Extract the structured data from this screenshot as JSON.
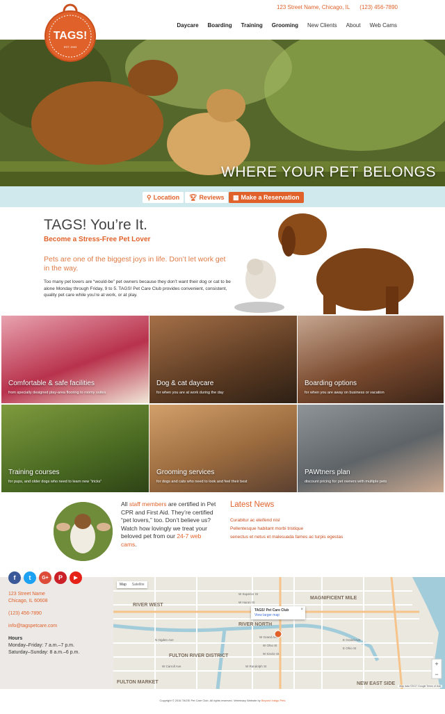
{
  "header": {
    "logo_text": "TAGS!",
    "logo_sub": "EST. 2003",
    "address": "123 Street Name, Chicago, IL",
    "phone": "(123) 456-7890",
    "nav": [
      {
        "label": "Daycare"
      },
      {
        "label": "Boarding"
      },
      {
        "label": "Training"
      },
      {
        "label": "Grooming"
      },
      {
        "label": "New Clients"
      },
      {
        "label": "About"
      },
      {
        "label": "Web Cams"
      }
    ]
  },
  "hero": {
    "tagline": "WHERE YOUR PET BELONGS"
  },
  "actions": {
    "location": "Location",
    "reviews": "Reviews",
    "reservation": "Make a Reservation"
  },
  "intro": {
    "title": "TAGS! You’re It.",
    "subtitle": "Become a Stress-Free Pet Lover",
    "lead": "Pets are one of the biggest joys in life. Don’t let work get in the way.",
    "body": "Too many pet lovers are “would-be” pet owners because they don’t want their dog or cat to be alone Monday through Friday, 9 to 5. TAGS! Pet Care Club provides convenient, consistent, quality pet care while you’re at work, or at play."
  },
  "tiles": [
    {
      "title": "Comfortable & safe facilities",
      "sub": "from specially designed play-area flooring to roomy suites"
    },
    {
      "title": "Dog & cat daycare",
      "sub": "for when you are at work during the day"
    },
    {
      "title": "Boarding options",
      "sub": "for when you are away on business or vacation"
    },
    {
      "title": "Training courses",
      "sub": "for pups, and older dogs who need to learn new “tricks”"
    },
    {
      "title": "Grooming services",
      "sub": "for dogs and cats who need to look and feel their best"
    },
    {
      "title": "PAWtners plan",
      "sub": "discount pricing for pet owners with multiple pets"
    }
  ],
  "staff": {
    "t1": "All ",
    "link1": "staff members",
    "t2": " are certified in Pet CPR and First Aid. They’re certified “pet lovers,” too. Don’t believe us? Watch how lovingly we treat your beloved pet from our ",
    "link2": "24-7 web cams",
    "t3": "."
  },
  "news": {
    "title": "Latest News",
    "items": [
      "Curabitur ac eleifend nisl",
      "Pellentesque habitant morbi tristique",
      "senectus et netus et malesuada fames ac turpis egestas"
    ]
  },
  "social": [
    {
      "name": "facebook-icon",
      "glyph": "f",
      "color": "#3b5998"
    },
    {
      "name": "twitter-icon",
      "glyph": "t",
      "color": "#1da1f2"
    },
    {
      "name": "google-plus-icon",
      "glyph": "G+",
      "color": "#dd4b39"
    },
    {
      "name": "pinterest-icon",
      "glyph": "P",
      "color": "#cb2027"
    },
    {
      "name": "youtube-icon",
      "glyph": "▶",
      "color": "#e62117"
    }
  ],
  "footer": {
    "street": "123 Street Name",
    "city": "Chicago, IL 60608",
    "phone": "(123) 456-7890",
    "email": "info@tagspetcare.com",
    "hours_title": "Hours",
    "hours_weekday": "Monday–Friday: 7 a.m.–7 p.m.",
    "hours_weekend": "Saturday–Sunday: 8 a.m.–6 p.m."
  },
  "map": {
    "tab_map": "Map",
    "tab_satellite": "Satellite",
    "popup_title": "TAGS! Pet Care Club",
    "popup_link": "View larger map",
    "labels": [
      "RIVER WEST",
      "RIVER NORTH",
      "MAGNIFICENT MILE",
      "FULTON RIVER DISTRICT",
      "FULTON MARKET",
      "NEW EAST SIDE"
    ],
    "streets": [
      "W Ohio St",
      "W Grand Ave",
      "W Kinzie St",
      "W Lake St",
      "W Randolph St",
      "W Hubbard St",
      "W Erie St",
      "W Huron St",
      "W Superior St",
      "W Chicago Ave",
      "N Orleans St",
      "N Wells St",
      "N Clark St",
      "N State St",
      "N Rush St",
      "E Ohio St",
      "E Grand Ave",
      "N Halsted St",
      "W Carroll Ave",
      "W Fulton St",
      "N Ogden Ave",
      "W Washington Blvd"
    ],
    "footer_text": "Map data ©2017 Google   Terms of Use"
  },
  "copyright": {
    "text": "Copyright © 2016 TAGS! Pet Care Club. All rights reserved. Veterinary Website by ",
    "link": "Beyond Indigo Pets"
  }
}
